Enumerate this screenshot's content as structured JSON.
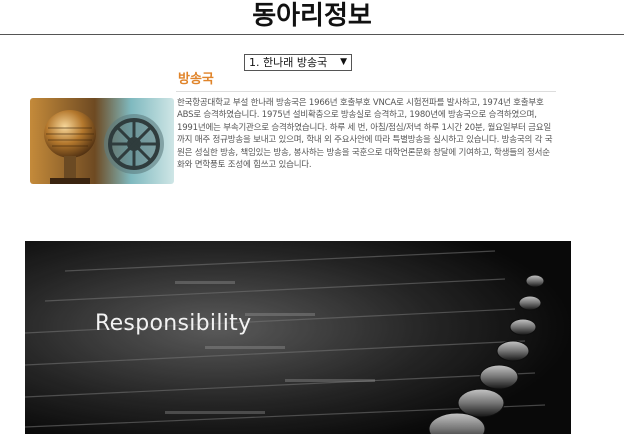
{
  "header": {
    "title": "동아리정보"
  },
  "club_selector": {
    "selected": "1. 한나래 방송국",
    "arrow": "▼"
  },
  "club": {
    "name": "방송국",
    "description": "한국항공대학교 부설 한나래 방송국은 1966년 호출부호 VNCA로 시험전파를 발사하고, 1974년 호출부호 ABS로 승격하였습니다. 1975년 설비확충으로 방송실로 승격하고, 1980년에 방송국으로 승격하였으며, 1991년에는 부속기관으로 승격하였습니다. 하루 세 번, 아침/점심/저녁 하루 1시간 20분, 월요일부터 금요일까지 매주 정규방송을 보내고 있으며, 학내 외 주요사안에 따라 특별방송을 실시하고 있습니다. 방송국의 각 국원은 성실한 방송, 책임있는 방송, 봉사하는 방송을 국훈으로 대학언론문화 창달에 기여하고, 학생들의 정서순화와 면학풍토 조성에 힘쓰고 있습니다."
  },
  "banner": {
    "text": "Responsibility"
  },
  "colors": {
    "accent": "#e0842a"
  }
}
